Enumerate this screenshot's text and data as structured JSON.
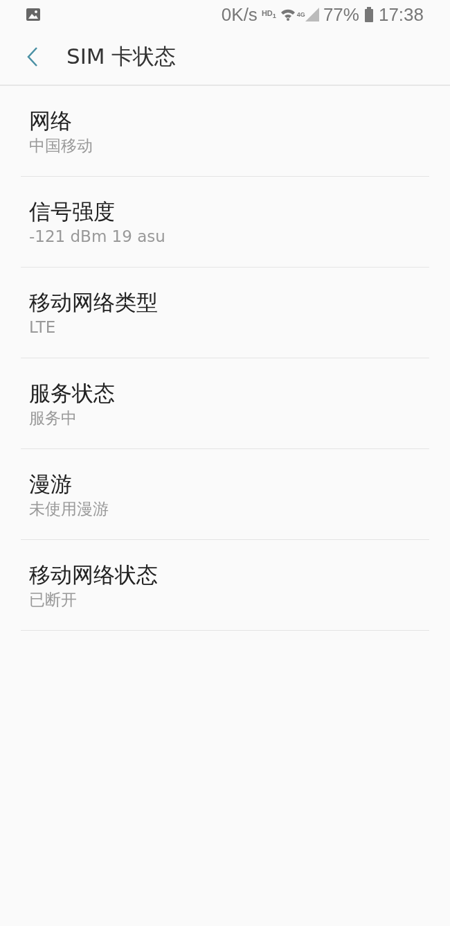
{
  "status_bar": {
    "speed": "0K/s",
    "hd": "HD$_{1}$",
    "network": "4G",
    "battery": "77%",
    "time": "17:38"
  },
  "header": {
    "title": "SIM 卡状态"
  },
  "items": [
    {
      "title": "网络",
      "value": "中国移动"
    },
    {
      "title": "信号强度",
      "value": "-121 dBm 19 asu"
    },
    {
      "title": "移动网络类型",
      "value": "LTE"
    },
    {
      "title": "服务状态",
      "value": "服务中"
    },
    {
      "title": "漫游",
      "value": "未使用漫游"
    },
    {
      "title": "移动网络状态",
      "value": "已断开"
    }
  ]
}
